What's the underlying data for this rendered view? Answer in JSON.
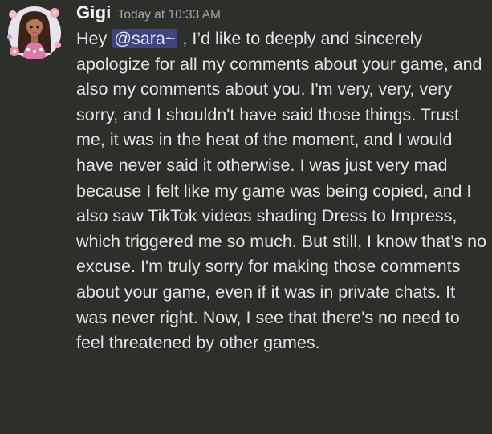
{
  "message": {
    "author": {
      "name": "Gigi",
      "avatar_icon": "avatar-icon"
    },
    "timestamp": "Today at 10:33 AM",
    "content": {
      "prefix": "Hey ",
      "mention": "@sara~",
      "body": " , I’d like to deeply and sincerely apologize for all my comments about your game, and also my comments about you. I'm very, very, very sorry, and I shouldn't have said those things. Trust me, it was in the heat of the moment, and I would have never said it otherwise. I was just very mad because I felt like my game was being copied, and I also saw TikTok videos shading Dress to Impress, which triggered me so much. But still, I know that’s no excuse. I'm truly sorry for making those comments about your game, even if it was in private chats. It was never right. Now, I see that there’s no need to feel threatened by other games."
    }
  },
  "colors": {
    "background": "#2d2f2a",
    "username": "#f2f3f5",
    "timestamp": "#a3a6aa",
    "text": "#e2e4e6",
    "mention_bg": "#5865f2",
    "mention_text": "#dee0fc"
  }
}
